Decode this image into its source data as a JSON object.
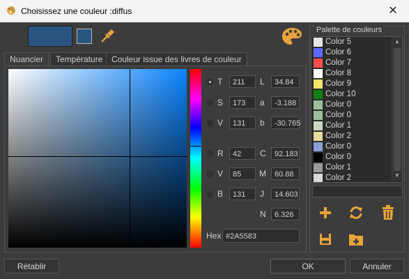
{
  "window": {
    "title": "Choisissez une couleur :diffus",
    "close_glyph": "✕"
  },
  "current_color": "#2A5583",
  "tabs": [
    {
      "label": "Nuancier",
      "active": true
    },
    {
      "label": "Température",
      "active": false
    },
    {
      "label": "Couleur issue des livres de couleur",
      "active": false
    }
  ],
  "hsv": [
    {
      "label": "T",
      "value": "211",
      "selected": true
    },
    {
      "label": "S",
      "value": "173",
      "selected": false
    },
    {
      "label": "V",
      "value": "131",
      "selected": false
    }
  ],
  "rgb": [
    {
      "label": "R",
      "value": "42"
    },
    {
      "label": "V",
      "value": "85"
    },
    {
      "label": "B",
      "value": "131"
    }
  ],
  "lab": [
    {
      "label": "L",
      "value": "34.84"
    },
    {
      "label": "a",
      "value": "-3.188"
    },
    {
      "label": "b",
      "value": "-30.765"
    }
  ],
  "cmyk": [
    {
      "label": "C",
      "value": "92.183"
    },
    {
      "label": "M",
      "value": "60.88"
    },
    {
      "label": "J",
      "value": "14.603"
    },
    {
      "label": "N",
      "value": "6.326"
    }
  ],
  "hex": {
    "label": "Hex",
    "value": "#2A5583"
  },
  "palette": {
    "title": "Palette de couleurs",
    "items": [
      {
        "name": "Color 5",
        "color": "#e6e6e6"
      },
      {
        "name": "Color 6",
        "color": "#5a6cff"
      },
      {
        "name": "Color 7",
        "color": "#ff4d4d"
      },
      {
        "name": "Color 8",
        "color": "#ffffff"
      },
      {
        "name": "Color 9",
        "color": "#f5e36b"
      },
      {
        "name": "Color 10",
        "color": "#0f7f0f"
      },
      {
        "name": "Color 0",
        "color": "#9cc09c"
      },
      {
        "name": "Color 0",
        "color": "#9cc09c"
      },
      {
        "name": "Color 1",
        "color": "#c9d9c0"
      },
      {
        "name": "Color 2",
        "color": "#e6dc9a"
      },
      {
        "name": "Color 0",
        "color": "#8aa0d8"
      },
      {
        "name": "Color 0",
        "color": "#000000"
      },
      {
        "name": "Color 1",
        "color": "#9a9a9a"
      },
      {
        "name": "Color 2",
        "color": "#d8d8d8"
      }
    ]
  },
  "buttons": {
    "reset": "Rétablir",
    "ok": "OK",
    "cancel": "Annuler"
  }
}
